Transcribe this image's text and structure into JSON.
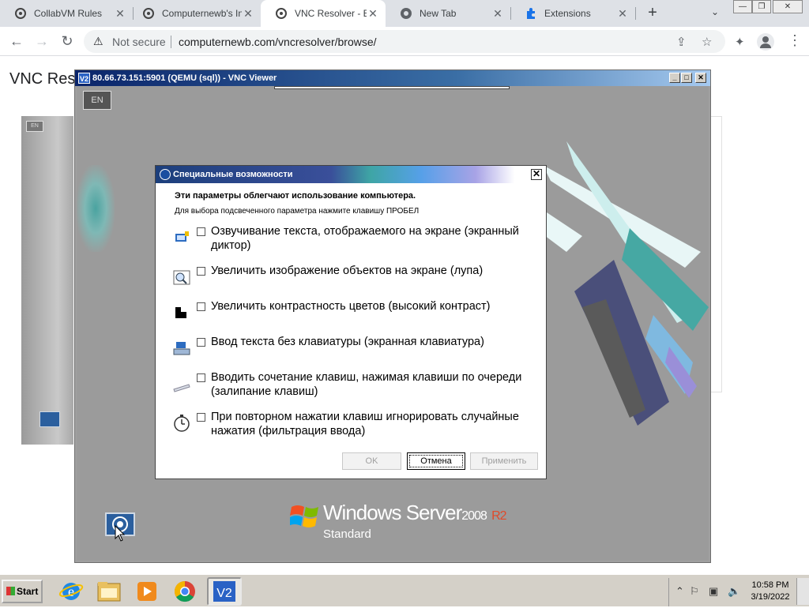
{
  "browser": {
    "tabs": [
      {
        "label": "CollabVM Rules",
        "icon": "collabvm-icon"
      },
      {
        "label": "Computernewb's In",
        "icon": "collabvm-icon"
      },
      {
        "label": "VNC Resolver - Bro",
        "icon": "collabvm-icon",
        "active": true
      },
      {
        "label": "New Tab",
        "icon": "chrome-icon"
      },
      {
        "label": "Extensions",
        "icon": "puzzle-icon"
      }
    ],
    "new_tab": "+",
    "tab_close": "✕",
    "tab_menu": "⌄",
    "window_controls": {
      "minimize": "—",
      "restore": "❐",
      "close": "✕"
    },
    "nav": {
      "back": "←",
      "forward": "→",
      "reload": "↻"
    },
    "address": {
      "security_warning": "⚠",
      "security_label": "Not secure",
      "url": "computernewb.com/vncresolver/browse/"
    },
    "toolbar_icons": {
      "share": "⇪",
      "bookmark": "☆",
      "extensions": "✦",
      "menu": "⋮"
    }
  },
  "page": {
    "title": "VNC Reso"
  },
  "vnc_window": {
    "title": "80.66.73.151:5901 (QEMU (sql)) - VNC Viewer",
    "app_icon": "V2",
    "buttons": {
      "minimize": "_",
      "maximize": "□",
      "close": "✕"
    },
    "lang_indicator": "EN",
    "small_lang_indicator": "EN"
  },
  "dialog": {
    "title": "Специальные возможности",
    "close": "✕",
    "heading": "Эти параметры облегчают использование компьютера.",
    "subheading": "Для выбора подсвеченного параметра нажмите клавишу ПРОБЕЛ",
    "options": [
      {
        "text": "Озвучивание текста, отображаемого на экране (экранный диктор)",
        "checked": false,
        "icon": "narrator-icon"
      },
      {
        "text": "Увеличить изображение объектов на экране (лупа)",
        "checked": false,
        "icon": "magnifier-icon"
      },
      {
        "text": "Увеличить контрастность цветов (высокий контраст)",
        "checked": false,
        "icon": "high-contrast-icon"
      },
      {
        "text": "Ввод текста без клавиатуры (экранная клавиатура)",
        "checked": false,
        "icon": "onscreen-keyboard-icon"
      },
      {
        "text": "Вводить сочетание клавиш, нажимая клавиши по очереди (залипание клавиш)",
        "checked": false,
        "icon": "sticky-keys-icon"
      },
      {
        "text": "При повторном нажатии клавиш игнорировать случайные нажатия (фильтрация ввода)",
        "checked": false,
        "icon": "filter-keys-icon"
      }
    ],
    "buttons": {
      "ok": "OK",
      "cancel": "Отмена",
      "apply": "Применить"
    }
  },
  "windows_logo": {
    "brand": "Windows Server",
    "version": "2008",
    "release": "R2",
    "edition": "Standard"
  },
  "taskbar": {
    "start_label": "Start",
    "apps": [
      "internet-explorer-icon",
      "file-explorer-icon",
      "media-player-icon",
      "chrome-icon",
      "vnc-viewer-icon"
    ],
    "tray_icons": [
      "show-hidden-icon",
      "flag-icon",
      "network-icon",
      "volume-muted-icon"
    ],
    "clock_time": "10:58 PM",
    "clock_date": "3/19/2022"
  },
  "colors": {
    "vnc_title": "#0a246a",
    "dialog_title": "#1c3f7c",
    "taskbar": "#d4d0c8",
    "chrome_tabstrip": "#dee1e6"
  }
}
